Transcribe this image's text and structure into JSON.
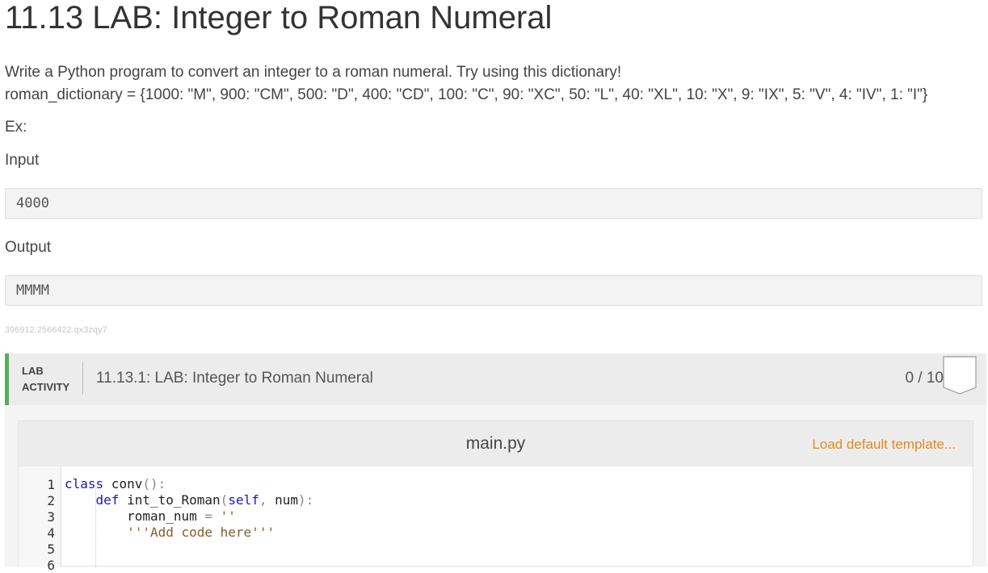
{
  "page": {
    "title": "11.13 LAB: Integer to Roman Numeral",
    "description": "Write a Python program to convert an integer to a roman numeral. Try using this dictionary!",
    "dictionary_line": "roman_dictionary = {1000: \"M\", 900: \"CM\", 500: \"D\", 400: \"CD\", 100: \"C\", 90: \"XC\", 50: \"L\", 40: \"XL\", 10: \"X\", 9: \"IX\", 5: \"V\", 4: \"IV\", 1: \"I\"}",
    "example_label": "Ex:",
    "input_label": "Input",
    "input_value": "4000",
    "output_label": "Output",
    "output_value": "MMMM",
    "reference_id": "396912.2566422.qx3zqy7"
  },
  "lab": {
    "tag_line1": "LAB",
    "tag_line2": "ACTIVITY",
    "name": "11.13.1: LAB: Integer to Roman Numeral",
    "score": "0 / 10",
    "accent_color": "#5aad5a",
    "badge_icon": "badge-shield-icon"
  },
  "editor": {
    "filename": "main.py",
    "load_template_label": "Load default template...",
    "link_color": "#e58a1f",
    "line_numbers": [
      "1",
      "2",
      "3",
      "4",
      "5",
      "6"
    ],
    "code": {
      "l1_kw": "class",
      "l1_rest": " conv",
      "l1_punc": "():",
      "l2_indent": "    ",
      "l2_kw": "def",
      "l2_rest": " int_to_Roman",
      "l2_p1": "(",
      "l2_self": "self",
      "l2_p2": ", ",
      "l2_num": "num",
      "l2_p3": "):",
      "l3_indent": "        ",
      "l3_var": "roman_num",
      "l3_eq": " = ",
      "l3_str": "''",
      "l4_indent": "        ",
      "l4_str": "'''Add code here'''"
    }
  }
}
